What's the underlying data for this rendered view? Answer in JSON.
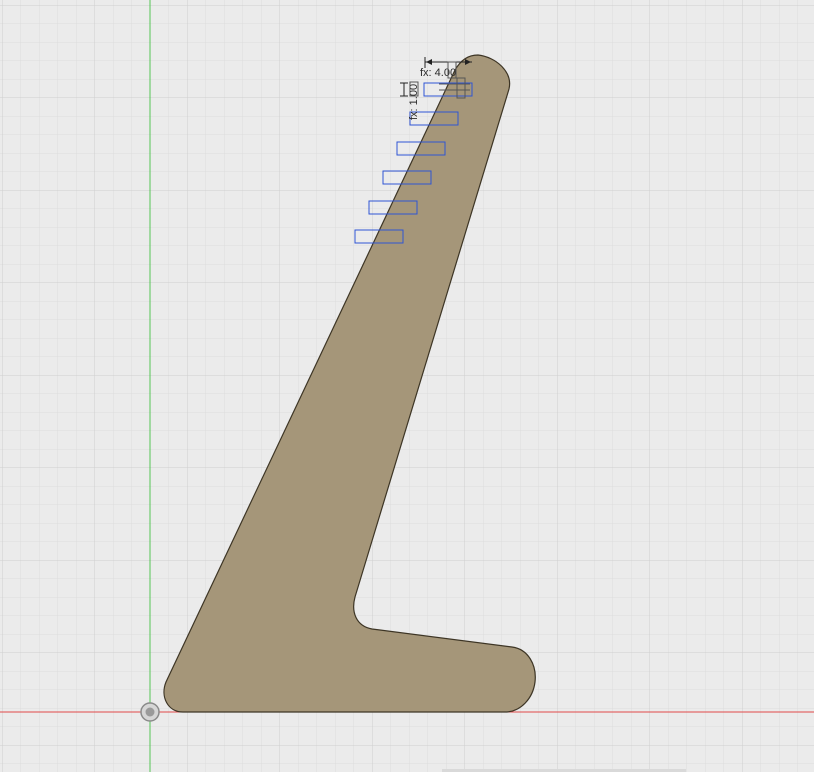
{
  "viewport": {
    "background_color": "#ebebeb",
    "grid_minor_color": "#dcdcdc",
    "grid_major_color": "#cfcfcf",
    "x_axis_color": "#e04a4a",
    "y_axis_color": "#54c454",
    "origin_marker_icon": "origin-point-icon"
  },
  "sketch": {
    "profile_fill_color": "#a59679",
    "profile_stroke_color": "#3d3525",
    "slot_color": "#2f55d4",
    "slot_count": 6,
    "dimensions": {
      "label_fx": "fx: 4.00",
      "label_vertical": "fx: 1.00"
    }
  }
}
